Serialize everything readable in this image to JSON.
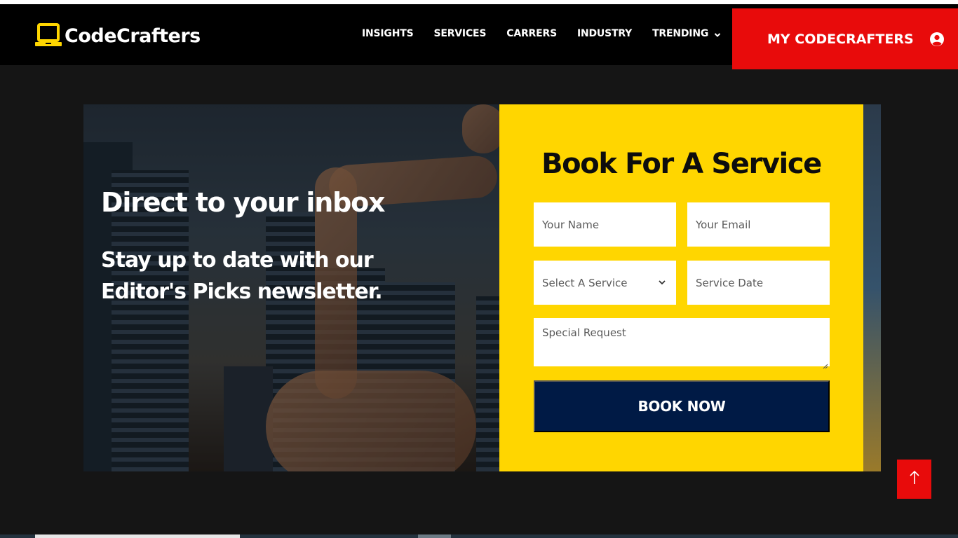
{
  "brand": {
    "name": "CodeCrafters",
    "logo_icon": "laptop-icon",
    "accent_color": "#ffd600"
  },
  "nav": {
    "items": [
      {
        "label": "INSIGHTS"
      },
      {
        "label": "SERVICES"
      },
      {
        "label": "CARRERS"
      },
      {
        "label": "INDUSTRY"
      },
      {
        "label": "TRENDING",
        "icon": "chevron-down-icon"
      }
    ],
    "cta": {
      "label": "MY CODECRAFTERS",
      "icon": "user-circle-icon",
      "color": "#e80b0b"
    }
  },
  "hero": {
    "title": "Direct to your inbox",
    "subtitle": "Stay up to date with our Editor's Picks newsletter."
  },
  "form": {
    "title": "Book For A Service",
    "name_placeholder": "Your Name",
    "email_placeholder": "Your Email",
    "service_selected": "Select A Service",
    "date_placeholder": "Service Date",
    "request_placeholder": "Special Request",
    "submit_label": "BOOK NOW",
    "card_color": "#ffd600",
    "button_color": "#001a45"
  },
  "scroll_top": {
    "icon": "arrow-up-icon",
    "color": "#e80b0b"
  }
}
